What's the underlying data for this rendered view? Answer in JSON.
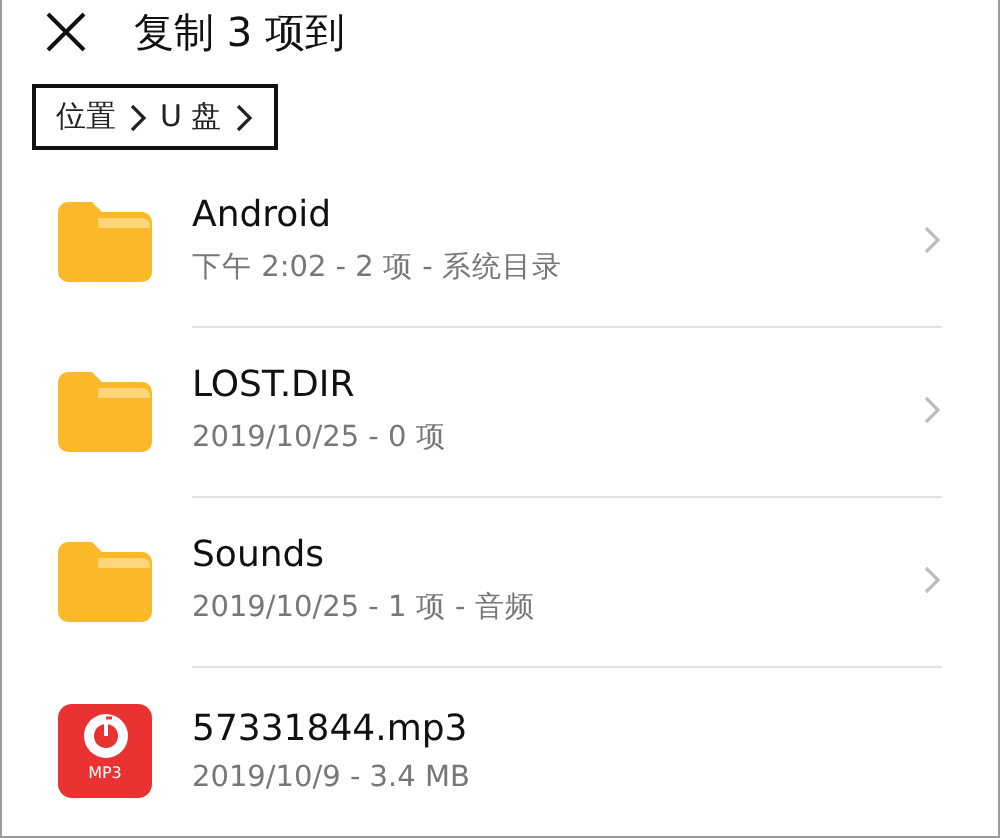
{
  "header": {
    "title": "复制 3 项到"
  },
  "breadcrumb": [
    {
      "label": "位置"
    },
    {
      "label": "U 盘"
    }
  ],
  "files": [
    {
      "kind": "folder",
      "name": "Android",
      "meta": "下午 2:02 - 2 项 - 系统目录"
    },
    {
      "kind": "folder",
      "name": "LOST.DIR",
      "meta": "2019/10/25 - 0 项"
    },
    {
      "kind": "folder",
      "name": "Sounds",
      "meta": "2019/10/25 - 1 项 - 音频"
    },
    {
      "kind": "audio",
      "name": "57331844.mp3",
      "meta": "2019/10/9 - 3.4 MB",
      "badge": "MP3"
    }
  ]
}
